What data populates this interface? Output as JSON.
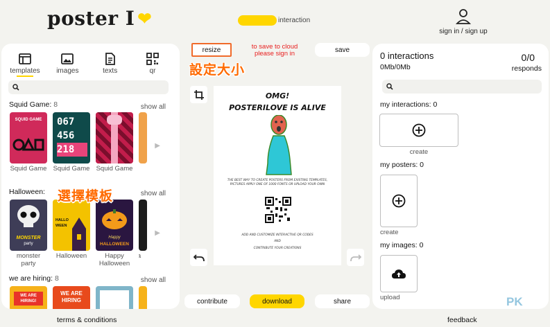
{
  "header": {
    "logo_text": "poster I",
    "interaction_label": "interaction",
    "signin_label": "sign in / sign up"
  },
  "left": {
    "tabs": [
      {
        "label": "templates",
        "icon": "layout-icon"
      },
      {
        "label": "images",
        "icon": "image-icon"
      },
      {
        "label": "texts",
        "icon": "document-icon"
      },
      {
        "label": "qr",
        "icon": "qr-icon"
      }
    ],
    "search_placeholder": "",
    "sections": [
      {
        "title": "Squid Game:",
        "count": "8",
        "show_all": "show all",
        "items": [
          "Squid Game",
          "Squid Game",
          "Squid Game"
        ]
      },
      {
        "title": "Halloween:",
        "count": "",
        "show_all": "show all",
        "items": [
          "monster party",
          "Halloween",
          "Happy Halloween",
          "Ha"
        ]
      },
      {
        "title": "we are hiring:",
        "count": "8",
        "show_all": "show all",
        "items": []
      }
    ],
    "thumb_texts": {
      "squid_logo": "SQUID GAME",
      "numbers": [
        "067",
        "456",
        "218"
      ],
      "monster": "MONSTER",
      "party": "party",
      "hallo_ween": "HALLO WEEN",
      "happy": "Happy",
      "halloween_word": "HALLOWEEN",
      "we_are_hiring": "WE ARE HIRING!",
      "we_are_hiring_2": "WE ARE HIRING"
    }
  },
  "middle": {
    "resize_label": "resize",
    "cloud_note_line1": "to save to cloud",
    "cloud_note_line2": "please sign in",
    "save_label": "save",
    "contribute_label": "contribute",
    "download_label": "download",
    "share_label": "share",
    "poster": {
      "title_line1": "OMG!",
      "title_line2": "POSTERILOVE IS ALIVE",
      "body": "THE BEST WAY TO CREATE POSTERS FROM EXISTING TEMPLATES, PICTURES APPLY ONE OF 1000 FONTS OR UPLOAD YOUR OWN",
      "add_line": "ADD AND CUSTOMIZE INTERACTIVE QR CODES",
      "and_line": "AND",
      "contribute_line": "CONTRIBUTE YOUR CREATIONS"
    }
  },
  "annotations": {
    "resize_note": "設定大小",
    "template_note": "選擇模板"
  },
  "right": {
    "interactions_count": "0",
    "interactions_label": "interactions",
    "storage": "0Mb/0Mb",
    "responds_count": "0/0",
    "responds_label": "responds",
    "search_placeholder": "",
    "my_interactions": "my interactions: 0",
    "create_label_1": "create",
    "my_posters": "my posters: 0",
    "create_label_2": "create",
    "my_images": "my images: 0",
    "upload_label": "upload"
  },
  "footer": {
    "terms": "terms & conditions",
    "feedback": "feedback",
    "watermark": "PK"
  },
  "colors": {
    "accent_yellow": "#ffd600",
    "annotation_orange": "#ff6a00",
    "cloud_note_red": "#e82020",
    "background": "#f3f3ef"
  }
}
